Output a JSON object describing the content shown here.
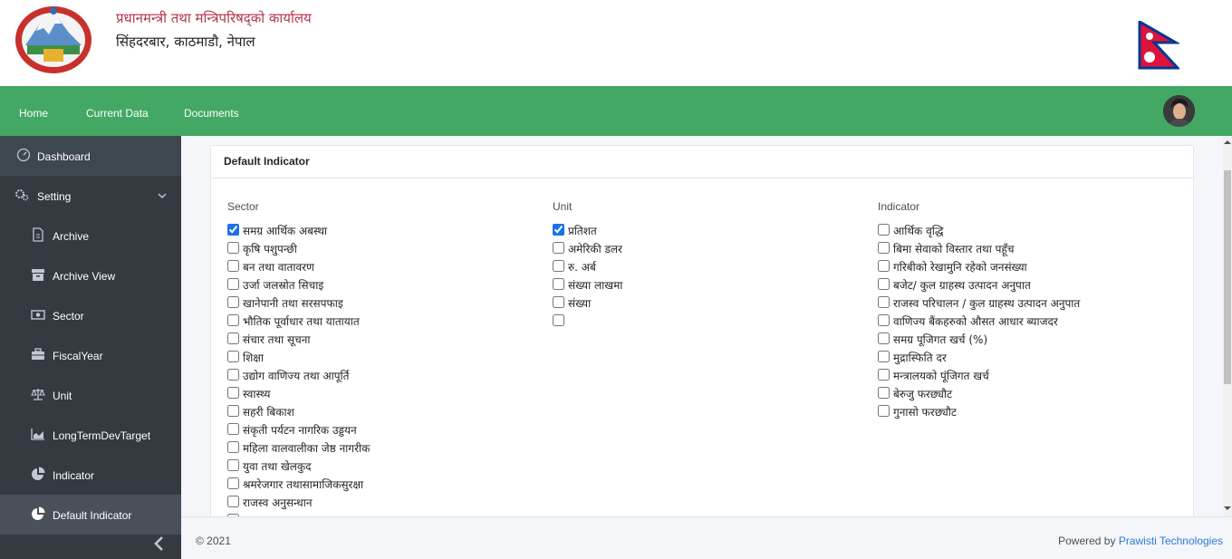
{
  "header": {
    "org_title": "प्रधानमन्त्री तथा मन्त्रिपरिषद्को कार्यालय",
    "org_address": "सिंहदरबार, काठमाडौ, नेपाल"
  },
  "nav": {
    "home": "Home",
    "current_data": "Current Data",
    "documents": "Documents"
  },
  "sidebar": {
    "items": [
      {
        "label": "Dashboard",
        "icon": "dashboard-gauge-icon"
      },
      {
        "label": "Setting",
        "icon": "gears-icon",
        "expanded": true
      },
      {
        "label": "Archive",
        "icon": "file-icon"
      },
      {
        "label": "Archive View",
        "icon": "archive-box-icon"
      },
      {
        "label": "Sector",
        "icon": "money-bill-icon"
      },
      {
        "label": "FiscalYear",
        "icon": "briefcase-icon"
      },
      {
        "label": "Unit",
        "icon": "balance-scale-icon"
      },
      {
        "label": "LongTermDevTarget",
        "icon": "area-chart-icon"
      },
      {
        "label": "Indicator",
        "icon": "pie-chart-icon"
      },
      {
        "label": "Default Indicator",
        "icon": "pie-chart-icon",
        "active": true
      }
    ]
  },
  "card": {
    "title": "Default Indicator",
    "sector": {
      "header": "Sector",
      "options": [
        {
          "label": "समग्र आर्थिक अबस्था",
          "checked": true
        },
        {
          "label": "कृषि पशुपन्छी",
          "checked": false
        },
        {
          "label": "बन तथा वातावरण",
          "checked": false
        },
        {
          "label": "उर्जा जलस्रोत सिचाइ",
          "checked": false
        },
        {
          "label": "खानेपानी तथा सरसपफाइ",
          "checked": false
        },
        {
          "label": "भौतिक पूर्वाधार तथा यातायात",
          "checked": false
        },
        {
          "label": "संचार तथा सूचना",
          "checked": false
        },
        {
          "label": "शिक्षा",
          "checked": false
        },
        {
          "label": "उद्योग वाणिज्य तथा आपूर्ति",
          "checked": false
        },
        {
          "label": "स्वास्थ्य",
          "checked": false
        },
        {
          "label": "सहरी बिकाश",
          "checked": false
        },
        {
          "label": "संकृती पर्यटन नागरिक उड्डयन",
          "checked": false
        },
        {
          "label": "महिला वालवालीका जेष्ठ नागरीक",
          "checked": false
        },
        {
          "label": "युवा तथा खेलकुद",
          "checked": false
        },
        {
          "label": "श्रमरेजगार तथासामाजिकसुरक्षा",
          "checked": false
        },
        {
          "label": "राजस्व अनुसन्धान",
          "checked": false
        },
        {
          "label": "",
          "checked": false
        }
      ]
    },
    "unit": {
      "header": "Unit",
      "options": [
        {
          "label": "प्रतिशत",
          "checked": true
        },
        {
          "label": "अमेरिकी डलर",
          "checked": false
        },
        {
          "label": "रु. अर्ब",
          "checked": false
        },
        {
          "label": "संख्या लाखमा",
          "checked": false
        },
        {
          "label": "संख्या",
          "checked": false
        },
        {
          "label": "",
          "checked": false
        }
      ]
    },
    "indicator": {
      "header": "Indicator",
      "options": [
        {
          "label": "आर्थिक वृद्धि",
          "checked": false
        },
        {
          "label": "बिमा सेवाको विस्तार तथा पहूँच",
          "checked": false
        },
        {
          "label": "गरिबीको रेखामुनि रहेको जनसंख्या",
          "checked": false
        },
        {
          "label": "बजेट/ कुल ग्राहस्थ उत्पादन अनुपात",
          "checked": false
        },
        {
          "label": "राजस्व परिचालन / कुल ग्राहस्थ उत्पादन अनुपात",
          "checked": false
        },
        {
          "label": "वाणिज्य बैंकहरुको औसत आधार ब्याजदर",
          "checked": false
        },
        {
          "label": "समग्र पूजिगत खर्च (%)",
          "checked": false
        },
        {
          "label": "मुद्रास्फिति दर",
          "checked": false
        },
        {
          "label": "मन्त्रालयको पूंजिगत खर्च",
          "checked": false
        },
        {
          "label": "बेरुजु फरछ्यौट",
          "checked": false
        },
        {
          "label": "गुनासो फरछ्यौट",
          "checked": false
        }
      ]
    }
  },
  "footer": {
    "copyright": "© 2021",
    "powered_by": "Powered by",
    "company": "Prawisti Technologies"
  },
  "colors": {
    "nav_green": "#43a864",
    "sidebar_bg": "#343a40",
    "title_red": "#b5334d",
    "link_blue": "#2a7ad6"
  }
}
